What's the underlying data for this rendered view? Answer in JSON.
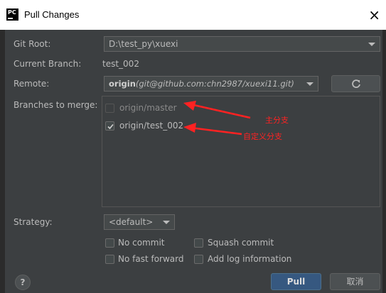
{
  "window": {
    "app_icon_text": "PC",
    "title": "Pull Changes",
    "close_glyph": "×"
  },
  "form": {
    "git_root_label": "Git Root:",
    "git_root_value": "D:\\test_py\\xuexi",
    "current_branch_label": "Current Branch:",
    "current_branch_value": "test_002",
    "remote_label": "Remote:",
    "remote_name": "origin",
    "remote_url": "(git@github.com:chn2987/xuexi11.git)",
    "refresh_icon": "refresh-icon",
    "branches_label": "Branches to merge:",
    "branches": [
      {
        "label": "origin/master",
        "checked": false,
        "enabled": false
      },
      {
        "label": "origin/test_002",
        "checked": true,
        "enabled": true
      }
    ],
    "strategy_label": "Strategy:",
    "strategy_value": "<default>"
  },
  "annotations": {
    "main_branch": "主分支",
    "custom_branch": "自定义分支",
    "color": "#ff2222"
  },
  "options": {
    "no_commit": "No commit",
    "squash_commit": "Squash commit",
    "no_fast_forward": "No fast forward",
    "add_log": "Add log information"
  },
  "footer": {
    "help_label": "?",
    "pull_label": "Pull",
    "cancel_label": "取消"
  },
  "colors": {
    "dialog_bg": "#3c3f41",
    "primary_button": "#365880"
  }
}
